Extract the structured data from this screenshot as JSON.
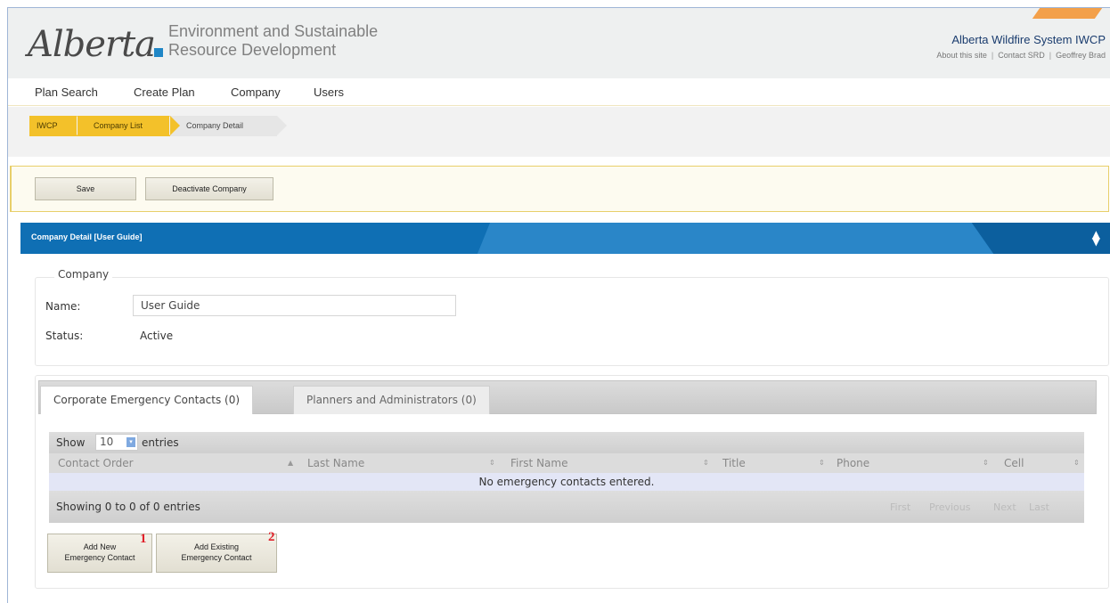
{
  "header": {
    "logo_text": "Alberta",
    "department_line1": "Environment and Sustainable",
    "department_line2": "Resource Development",
    "system_title": "Alberta Wildfire System IWCP",
    "links": [
      "About this site",
      "Contact SRD",
      "Geoffrey Brad"
    ],
    "accent_color": "#f3a04a",
    "brand_color": "#1f86c6"
  },
  "nav": {
    "items": [
      "Plan Search",
      "Create Plan",
      "Company",
      "Users"
    ]
  },
  "breadcrumb": {
    "items": [
      "IWCP",
      "Company List",
      "Company Detail"
    ]
  },
  "toolbar": {
    "save_label": "Save",
    "deactivate_label": "Deactivate Company"
  },
  "panel": {
    "title": "Company Detail [User Guide]",
    "toggle_icon": "sort-toggle-icon",
    "header_color": "#0f6fb4"
  },
  "company": {
    "legend": "Company",
    "name_label": "Name:",
    "name_value": "User Guide",
    "status_label": "Status:",
    "status_value": "Active"
  },
  "tabs": [
    {
      "label": "Corporate Emergency Contacts (0)",
      "active": true
    },
    {
      "label": "Planners and Administrators (0)",
      "active": false
    }
  ],
  "table": {
    "show_label": "Show",
    "page_size": "10",
    "entries_label": "entries",
    "columns": [
      "Contact Order",
      "Last Name",
      "First Name",
      "Title",
      "Phone",
      "Cell"
    ],
    "empty_message": "No emergency contacts entered.",
    "info": "Showing 0 to 0 of 0 entries",
    "pager": [
      "First",
      "Previous",
      "Next",
      "Last"
    ]
  },
  "actions": {
    "add_new_line1": "Add New",
    "add_new_line2": "Emergency Contact",
    "add_new_marker": "1",
    "add_existing_line1": "Add Existing",
    "add_existing_line2": "Emergency Contact",
    "add_existing_marker": "2"
  }
}
